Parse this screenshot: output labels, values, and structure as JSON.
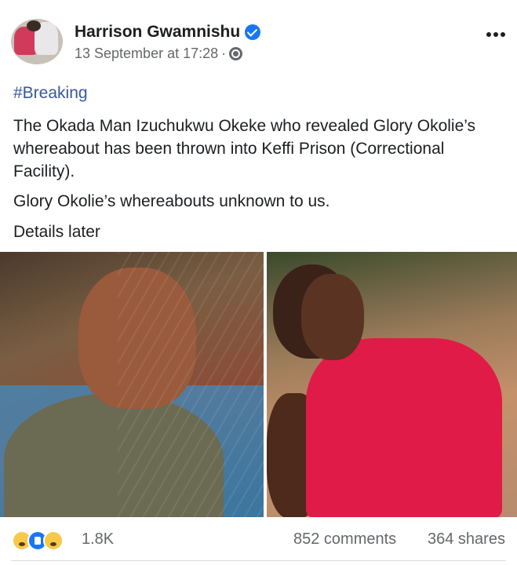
{
  "post": {
    "author": "Harrison Gwamnishu",
    "timestamp": "13 September at 17:28",
    "separator": "·",
    "hashtag": "#Breaking",
    "paragraphs": [
      "The Okada Man Izuchukwu Okeke who revealed Glory Okolie’s whereabout has been thrown into Keffi Prison (Correctional Facility).",
      "Glory Okolie’s whereabouts unknown to us.",
      "Details later"
    ]
  },
  "footer": {
    "reaction_count": "1.8K",
    "comments": "852 comments",
    "shares": "364 shares"
  },
  "icons": {
    "verified": "verified-badge-icon",
    "audience": "globe-icon",
    "more": "more-options-icon",
    "reactions": [
      "sad-reaction-icon",
      "like-reaction-icon",
      "wow-reaction-icon"
    ]
  },
  "colors": {
    "accent": "#1877f2",
    "hashtag": "#385898",
    "muted": "#65676b"
  }
}
